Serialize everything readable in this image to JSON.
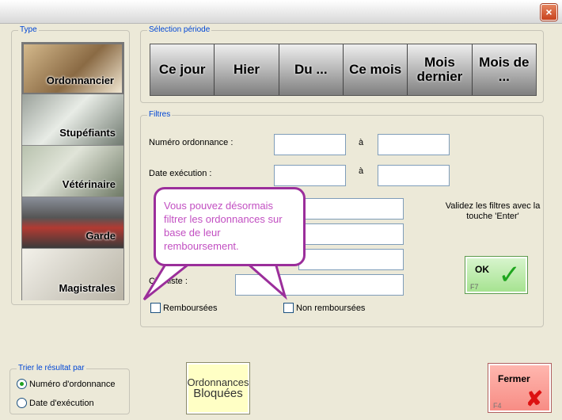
{
  "window": {
    "close_symbol": "×"
  },
  "type_group": {
    "label": "Type",
    "items": [
      {
        "label": "Ordonnancier",
        "selected": true
      },
      {
        "label": "Stupéfiants"
      },
      {
        "label": "Vétérinaire"
      },
      {
        "label": "Garde"
      },
      {
        "label": "Magistrales"
      }
    ]
  },
  "period_group": {
    "label": "Sélection période",
    "buttons": [
      "Ce jour",
      "Hier",
      "Du ...",
      "Ce mois",
      "Mois dernier",
      "Mois de ..."
    ]
  },
  "filters": {
    "label": "Filtres",
    "numero_label": "Numéro ordonnance :",
    "date_label": "Date exécution :",
    "a_label": "à",
    "chimiste_label": "Chimiste :",
    "rembourse_label": "Remboursées",
    "non_rembourse_label": "Non remboursées",
    "hint": "Validez les filtres avec la touche 'Enter'",
    "ok_label": "OK",
    "ok_key": "F7"
  },
  "callout": {
    "text": "Vous pouvez désormais filtrer les ordonnances sur base de leur remboursement."
  },
  "sort_group": {
    "label": "Trier le résultat par",
    "options": [
      {
        "label": "Numéro d'ordonnance",
        "selected": true
      },
      {
        "label": "Date d'exécution",
        "selected": false
      }
    ]
  },
  "blocked_button": {
    "line1": "Ordonnances",
    "line2": "Bloquées"
  },
  "close_button": {
    "label": "Fermer",
    "key": "F4"
  },
  "colors": {
    "accent_label": "#0046d5",
    "callout_border": "#9b2e9b",
    "callout_text": "#c24fc2",
    "ok_bg": "#a4e28e",
    "close_bg": "#f78b83"
  }
}
